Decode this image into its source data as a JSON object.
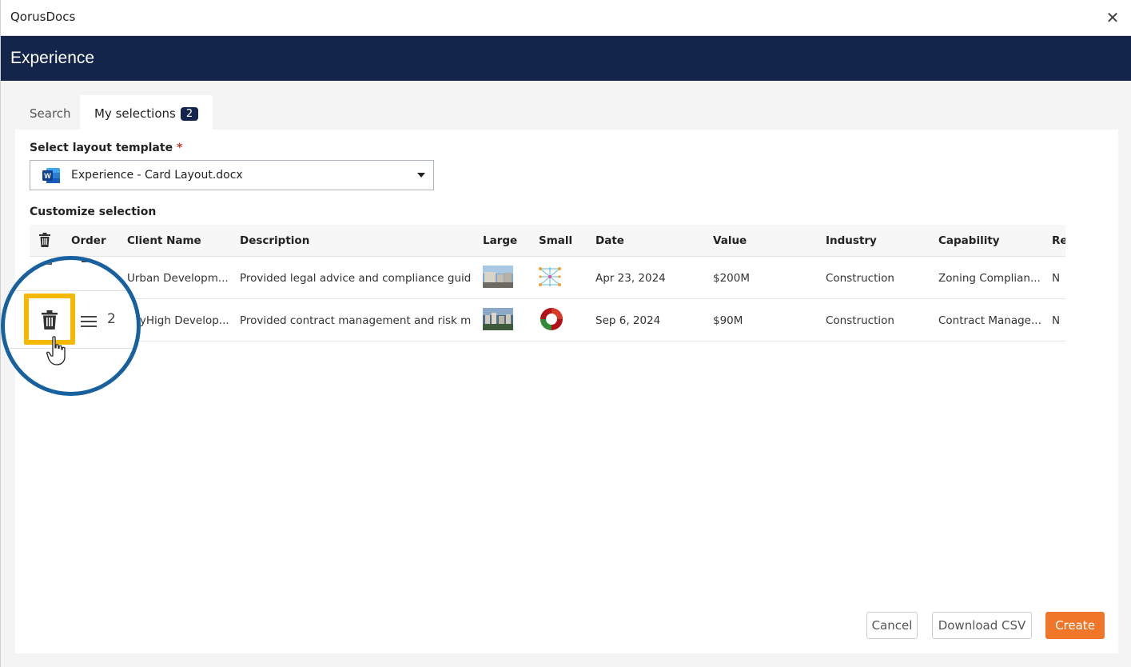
{
  "app_title": "QorusDocs",
  "header_title": "Experience",
  "tabs": {
    "search": "Search",
    "my_selections": "My selections",
    "selection_count": "2"
  },
  "layout_field": {
    "label": "Select layout template",
    "required_mark": "*",
    "value": "Experience - Card Layout.docx"
  },
  "customize_label": "Customize selection",
  "table": {
    "headers": {
      "order": "Order",
      "client": "Client Name",
      "description": "Description",
      "large": "Large",
      "small": "Small",
      "date": "Date",
      "value": "Value",
      "industry": "Industry",
      "capability": "Capability",
      "re": "Re"
    },
    "rows": [
      {
        "client": "Urban Developm...",
        "description": "Provided legal advice and compliance guida...",
        "date": "Apr 23, 2024",
        "value": "$200M",
        "industry": "Construction",
        "capability": "Zoning Complian...",
        "re": "N"
      },
      {
        "client": "SkyHigh Develop...",
        "description": "Provided contract management and risk mit...",
        "date": "Sep 6, 2024",
        "value": "$90M",
        "industry": "Construction",
        "capability": "Contract Manage...",
        "re": "N"
      }
    ]
  },
  "magnifier": {
    "order_number": "2"
  },
  "buttons": {
    "cancel": "Cancel",
    "download_csv": "Download CSV",
    "create": "Create"
  },
  "colors": {
    "header_bg": "#13254a",
    "accent": "#f0762a",
    "highlight": "#f5b800",
    "magnifier_ring": "#16619e"
  },
  "icons": [
    "close-icon",
    "trash-icon",
    "word-icon",
    "chevron-down-icon",
    "drag-handle-icon",
    "pointer-hand-icon"
  ]
}
